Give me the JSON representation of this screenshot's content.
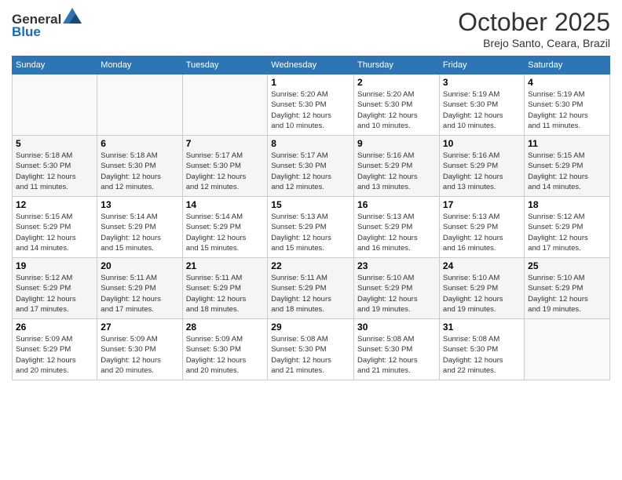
{
  "header": {
    "logo_line1": "General",
    "logo_line2": "Blue",
    "month": "October 2025",
    "location": "Brejo Santo, Ceara, Brazil"
  },
  "weekdays": [
    "Sunday",
    "Monday",
    "Tuesday",
    "Wednesday",
    "Thursday",
    "Friday",
    "Saturday"
  ],
  "weeks": [
    [
      {
        "day": "",
        "info": ""
      },
      {
        "day": "",
        "info": ""
      },
      {
        "day": "",
        "info": ""
      },
      {
        "day": "1",
        "info": "Sunrise: 5:20 AM\nSunset: 5:30 PM\nDaylight: 12 hours\nand 10 minutes."
      },
      {
        "day": "2",
        "info": "Sunrise: 5:20 AM\nSunset: 5:30 PM\nDaylight: 12 hours\nand 10 minutes."
      },
      {
        "day": "3",
        "info": "Sunrise: 5:19 AM\nSunset: 5:30 PM\nDaylight: 12 hours\nand 10 minutes."
      },
      {
        "day": "4",
        "info": "Sunrise: 5:19 AM\nSunset: 5:30 PM\nDaylight: 12 hours\nand 11 minutes."
      }
    ],
    [
      {
        "day": "5",
        "info": "Sunrise: 5:18 AM\nSunset: 5:30 PM\nDaylight: 12 hours\nand 11 minutes."
      },
      {
        "day": "6",
        "info": "Sunrise: 5:18 AM\nSunset: 5:30 PM\nDaylight: 12 hours\nand 12 minutes."
      },
      {
        "day": "7",
        "info": "Sunrise: 5:17 AM\nSunset: 5:30 PM\nDaylight: 12 hours\nand 12 minutes."
      },
      {
        "day": "8",
        "info": "Sunrise: 5:17 AM\nSunset: 5:30 PM\nDaylight: 12 hours\nand 12 minutes."
      },
      {
        "day": "9",
        "info": "Sunrise: 5:16 AM\nSunset: 5:29 PM\nDaylight: 12 hours\nand 13 minutes."
      },
      {
        "day": "10",
        "info": "Sunrise: 5:16 AM\nSunset: 5:29 PM\nDaylight: 12 hours\nand 13 minutes."
      },
      {
        "day": "11",
        "info": "Sunrise: 5:15 AM\nSunset: 5:29 PM\nDaylight: 12 hours\nand 14 minutes."
      }
    ],
    [
      {
        "day": "12",
        "info": "Sunrise: 5:15 AM\nSunset: 5:29 PM\nDaylight: 12 hours\nand 14 minutes."
      },
      {
        "day": "13",
        "info": "Sunrise: 5:14 AM\nSunset: 5:29 PM\nDaylight: 12 hours\nand 15 minutes."
      },
      {
        "day": "14",
        "info": "Sunrise: 5:14 AM\nSunset: 5:29 PM\nDaylight: 12 hours\nand 15 minutes."
      },
      {
        "day": "15",
        "info": "Sunrise: 5:13 AM\nSunset: 5:29 PM\nDaylight: 12 hours\nand 15 minutes."
      },
      {
        "day": "16",
        "info": "Sunrise: 5:13 AM\nSunset: 5:29 PM\nDaylight: 12 hours\nand 16 minutes."
      },
      {
        "day": "17",
        "info": "Sunrise: 5:13 AM\nSunset: 5:29 PM\nDaylight: 12 hours\nand 16 minutes."
      },
      {
        "day": "18",
        "info": "Sunrise: 5:12 AM\nSunset: 5:29 PM\nDaylight: 12 hours\nand 17 minutes."
      }
    ],
    [
      {
        "day": "19",
        "info": "Sunrise: 5:12 AM\nSunset: 5:29 PM\nDaylight: 12 hours\nand 17 minutes."
      },
      {
        "day": "20",
        "info": "Sunrise: 5:11 AM\nSunset: 5:29 PM\nDaylight: 12 hours\nand 17 minutes."
      },
      {
        "day": "21",
        "info": "Sunrise: 5:11 AM\nSunset: 5:29 PM\nDaylight: 12 hours\nand 18 minutes."
      },
      {
        "day": "22",
        "info": "Sunrise: 5:11 AM\nSunset: 5:29 PM\nDaylight: 12 hours\nand 18 minutes."
      },
      {
        "day": "23",
        "info": "Sunrise: 5:10 AM\nSunset: 5:29 PM\nDaylight: 12 hours\nand 19 minutes."
      },
      {
        "day": "24",
        "info": "Sunrise: 5:10 AM\nSunset: 5:29 PM\nDaylight: 12 hours\nand 19 minutes."
      },
      {
        "day": "25",
        "info": "Sunrise: 5:10 AM\nSunset: 5:29 PM\nDaylight: 12 hours\nand 19 minutes."
      }
    ],
    [
      {
        "day": "26",
        "info": "Sunrise: 5:09 AM\nSunset: 5:29 PM\nDaylight: 12 hours\nand 20 minutes."
      },
      {
        "day": "27",
        "info": "Sunrise: 5:09 AM\nSunset: 5:30 PM\nDaylight: 12 hours\nand 20 minutes."
      },
      {
        "day": "28",
        "info": "Sunrise: 5:09 AM\nSunset: 5:30 PM\nDaylight: 12 hours\nand 20 minutes."
      },
      {
        "day": "29",
        "info": "Sunrise: 5:08 AM\nSunset: 5:30 PM\nDaylight: 12 hours\nand 21 minutes."
      },
      {
        "day": "30",
        "info": "Sunrise: 5:08 AM\nSunset: 5:30 PM\nDaylight: 12 hours\nand 21 minutes."
      },
      {
        "day": "31",
        "info": "Sunrise: 5:08 AM\nSunset: 5:30 PM\nDaylight: 12 hours\nand 22 minutes."
      },
      {
        "day": "",
        "info": ""
      }
    ]
  ]
}
